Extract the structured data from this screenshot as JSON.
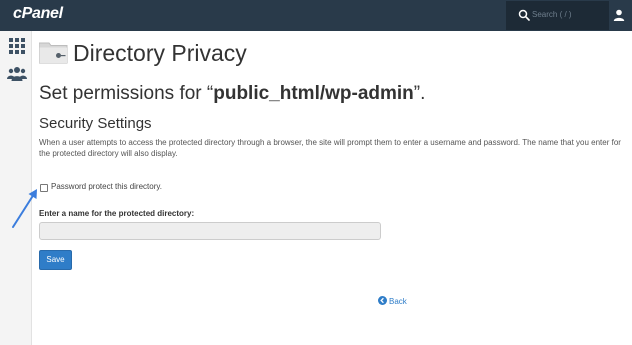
{
  "topbar": {
    "logo": "cPanel",
    "search_placeholder": "Search ( / )",
    "icons": {
      "search": "search-icon",
      "user": "user-icon"
    }
  },
  "sidebar": {
    "icons": [
      "grid-icon",
      "users-icon"
    ]
  },
  "header": {
    "title": "Directory Privacy",
    "icon": "folder-icon"
  },
  "permissions": {
    "prefix": "Set permissions for “",
    "path": "public_html/wp-admin",
    "suffix": "”."
  },
  "security": {
    "title": "Security Settings",
    "description": "When a user attempts to access the protected directory through a browser, the site will prompt them to enter a username and password. The name that you enter for the protected directory will also display.",
    "checkbox_label": "Password protect this directory.",
    "checkbox_checked": false,
    "name_label": "Enter a name for the protected directory:",
    "name_value": "",
    "save_label": "Save"
  },
  "back": {
    "label": "Back",
    "icon": "back-circle-icon"
  },
  "colors": {
    "topbar": "#293a4a",
    "accent": "#2f7dc8",
    "annotation_arrow": "#3b7ddd"
  }
}
